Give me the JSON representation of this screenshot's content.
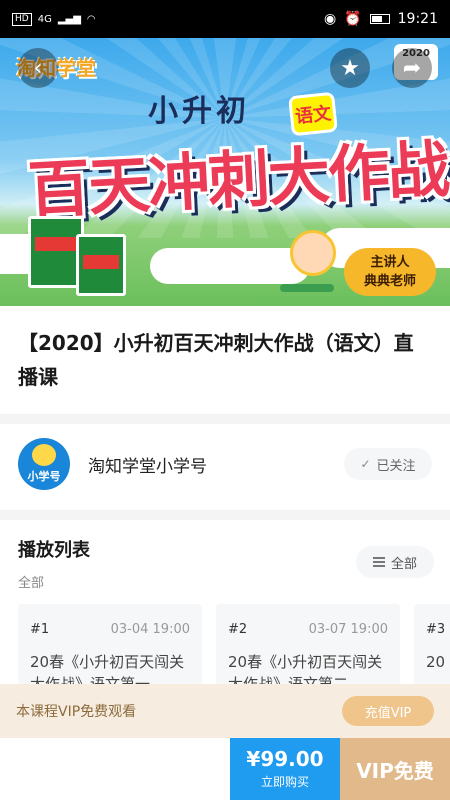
{
  "status_bar": {
    "left_icons": [
      "HD",
      "4G",
      "signal",
      "wifi"
    ],
    "right_icons": [
      "eye-icon",
      "alarm-icon",
      "battery-icon"
    ],
    "time": "19:21"
  },
  "banner": {
    "logo_text": "淘知学堂",
    "year_badge": "2020",
    "subtitle": "小升初",
    "subject_tag": "语文",
    "main_title": "百天冲刺大作战",
    "lecturer_line1": "主讲人",
    "lecturer_line2": "典典老师"
  },
  "course": {
    "title": "【2020】小升初百天冲刺大作战（语文）直播课"
  },
  "author": {
    "avatar_label": "小学号",
    "name": "淘知学堂小学号",
    "follow_label": "已关注"
  },
  "playlist": {
    "title": "播放列表",
    "filter": "全部",
    "all_label": "全部",
    "episodes": [
      {
        "num": "#1",
        "date": "03-04 19:00",
        "title": "20春《小升初百天闯关大作战》语文第一"
      },
      {
        "num": "#2",
        "date": "03-07 19:00",
        "title": "20春《小升初百天闯关大作战》语文第二"
      },
      {
        "num": "#3",
        "date": "",
        "title": "20"
      }
    ]
  },
  "vip_strip": {
    "text": "本课程VIP免费观看",
    "button": "充值VIP"
  },
  "bottom_bar": {
    "price": "¥99.00",
    "buy_label": "立即购买",
    "vip_free": "VIP免费"
  },
  "colors": {
    "buy_blue": "#1f9bf0",
    "vip_gold": "#e1b98b",
    "vip_strip_bg": "#f6ecdf"
  }
}
